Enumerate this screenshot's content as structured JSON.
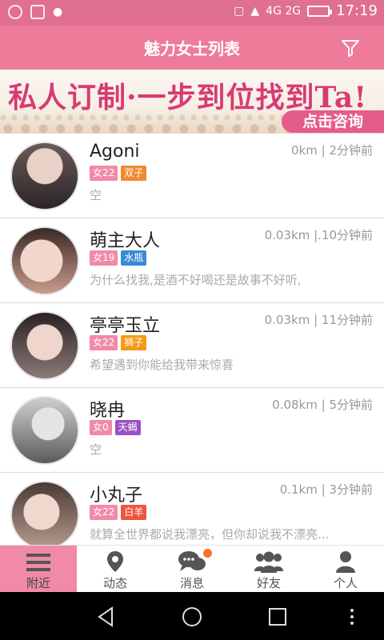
{
  "status_bar": {
    "time": "17:19",
    "network": "4G 2G"
  },
  "header": {
    "title": "魅力女士列表"
  },
  "banner": {
    "headline": "私人订制·一步到位找到Ta!",
    "cta": "点击咨询"
  },
  "colors": {
    "brand": "#ee7b9a",
    "tab_active": "#f08aa6",
    "badge_dot": "#ff6f2b"
  },
  "users": [
    {
      "name": "Agoni",
      "gender": "女22",
      "sign": "双子",
      "sign_color": "#f08a2e",
      "distance": "0km",
      "time": "2分钟前",
      "desc": "空"
    },
    {
      "name": "萌主大人",
      "gender": "女19",
      "sign": "水瓶",
      "sign_color": "#3a8ad6",
      "distance": "0.03km",
      "time": ".10分钟前",
      "desc": "为什么找我,是酒不好喝还是故事不好听,"
    },
    {
      "name": "亭亭玉立",
      "gender": "女22",
      "sign": "狮子",
      "sign_color": "#f39a17",
      "distance": "0.03km",
      "time": "11分钟前",
      "desc": "希望遇到你能给我带来惊喜"
    },
    {
      "name": "晓冉",
      "gender": "女0",
      "sign": "天蝎",
      "sign_color": "#9b51c2",
      "distance": "0.08km",
      "time": "5分钟前",
      "desc": "空"
    },
    {
      "name": "小丸子",
      "gender": "女22",
      "sign": "白羊",
      "sign_color": "#f0533d",
      "distance": "0.1km",
      "time": "3分钟前",
      "desc": "就算全世界都说我漂亮，但你却说我不漂亮..."
    }
  ],
  "tabs": [
    {
      "label": "附近",
      "icon": "menu-icon"
    },
    {
      "label": "动态",
      "icon": "location-pin-icon"
    },
    {
      "label": "消息",
      "icon": "chat-icon"
    },
    {
      "label": "好友",
      "icon": "friends-icon"
    },
    {
      "label": "个人",
      "icon": "person-icon"
    }
  ]
}
